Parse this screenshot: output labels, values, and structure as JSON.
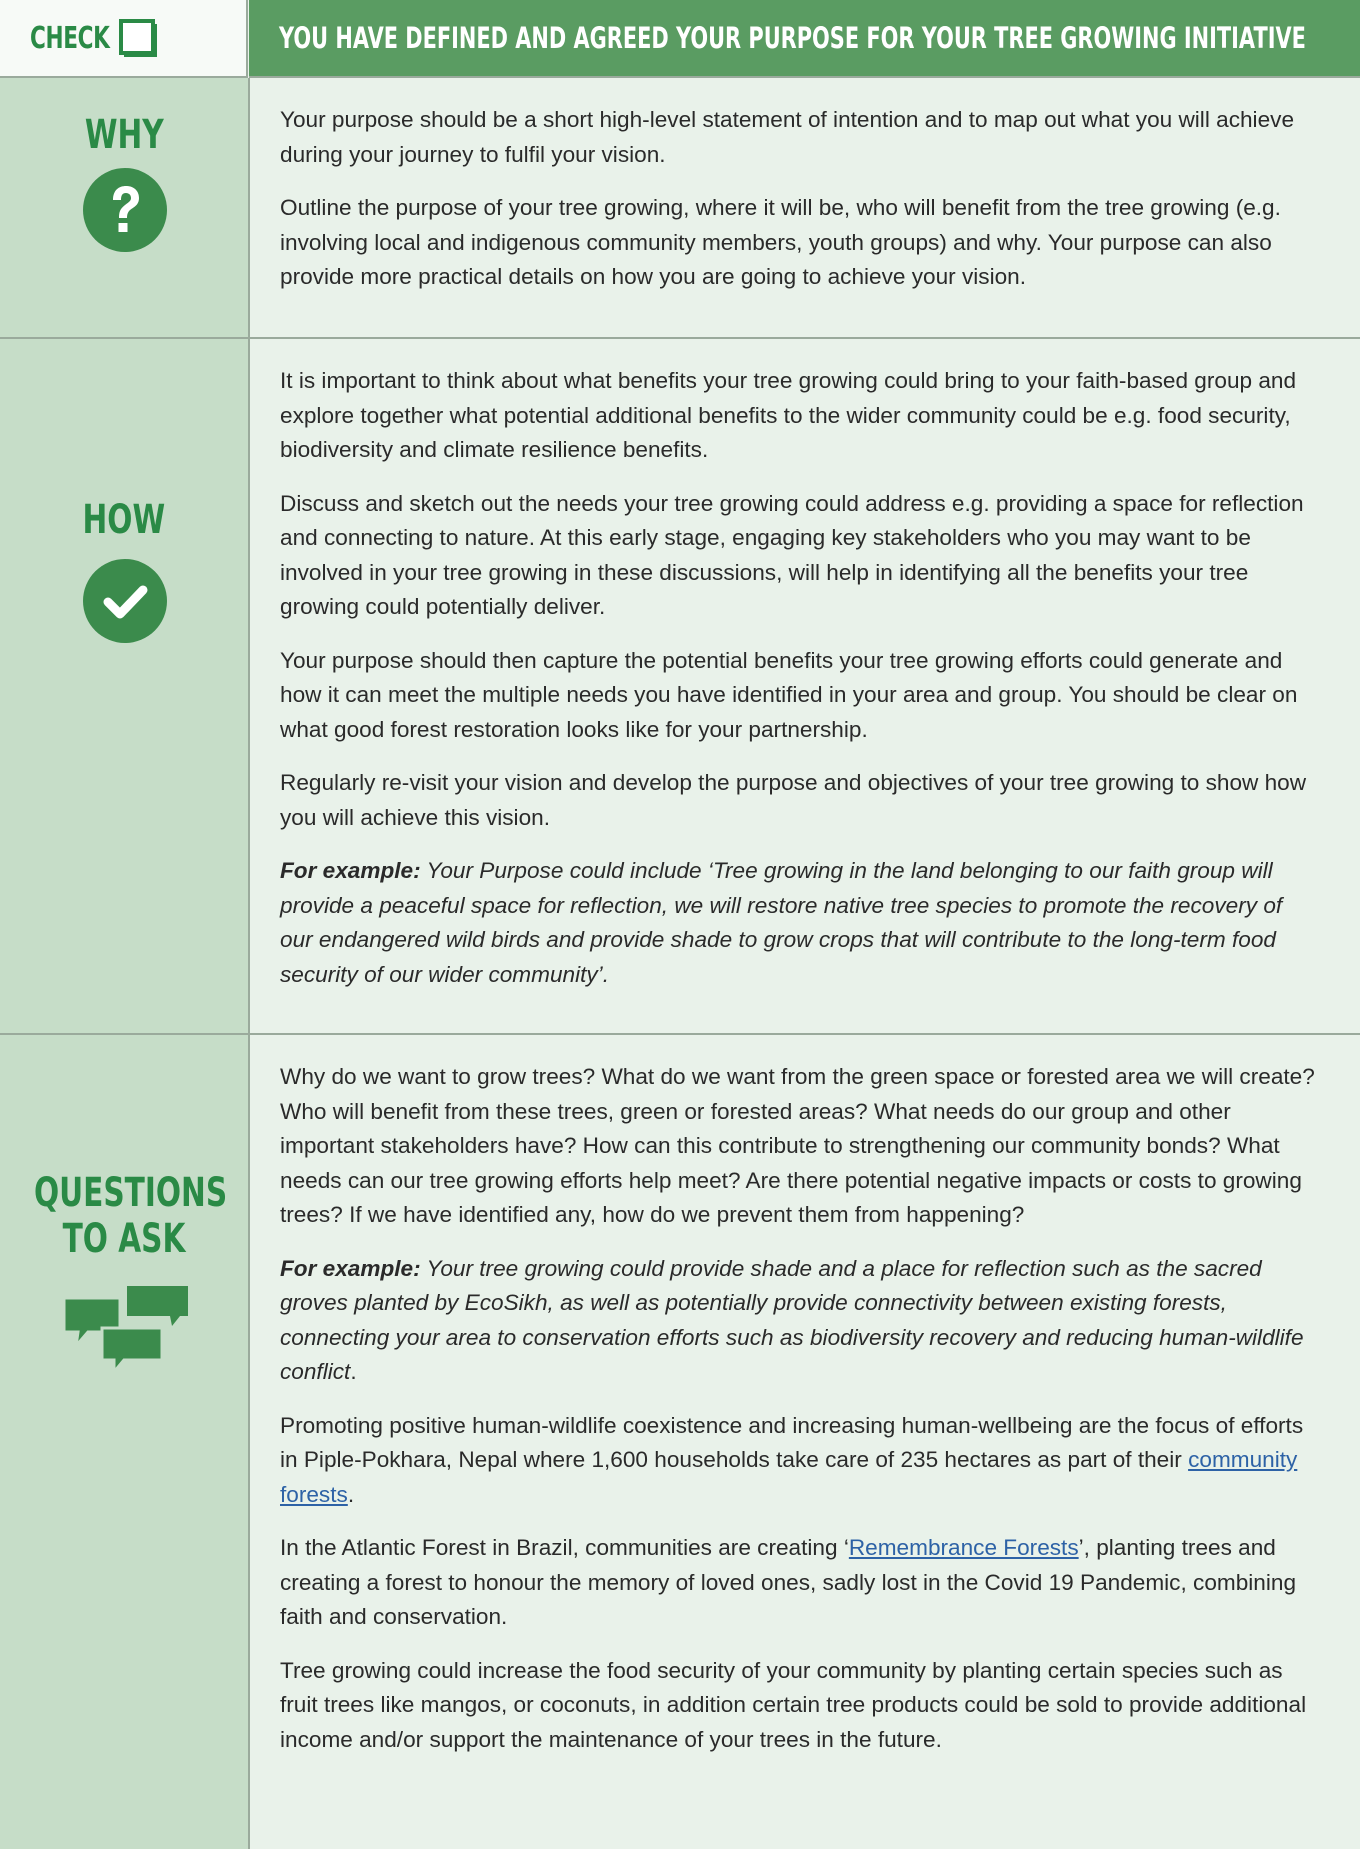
{
  "header": {
    "check_label": "CHECK",
    "title": "YOU HAVE DEFINED AND AGREED YOUR PURPOSE FOR YOUR TREE GROWING INITIATIVE"
  },
  "why": {
    "label": "WHY",
    "icon": "question-icon",
    "paragraphs": [
      "Your purpose should be a short high-level statement of intention and to map out what you will achieve during your journey to fulfil your vision.",
      "Outline the purpose of your tree growing, where it will be, who will benefit from the tree growing (e.g. involving local and indigenous community members, youth groups) and why. Your purpose can also provide more practical details on how you are going to achieve your vision."
    ]
  },
  "how": {
    "label": "HOW",
    "icon": "checkmark-icon",
    "paragraphs": [
      "It is important to think about what benefits your tree growing could bring to your faith-based group and explore together what potential additional benefits to the wider community could be e.g. food security, biodiversity and climate resilience benefits.",
      "Discuss and sketch out the needs your tree growing could address e.g. providing a space for reflection and connecting to nature. At this early stage, engaging key stakeholders who you may want to be involved in your tree growing in these discussions, will help in identifying all the benefits your tree growing could potentially deliver.",
      "Your purpose should then capture the potential benefits your tree growing efforts could generate and how it can meet the multiple needs you have identified in your area and group. You should be clear on what good forest restoration looks like for your partnership.",
      "Regularly re-visit your vision and develop the purpose and objectives of your tree growing to show how you will achieve this vision."
    ],
    "example_lead": "For example:",
    "example_text": " Your Purpose could include ‘Tree growing in the land belonging to our faith group will provide a peaceful space for reflection, we will restore native tree species to promote the recovery of our endangered wild birds and provide shade to grow crops that will contribute to the long-term food security of our wider community’."
  },
  "questions": {
    "label_line1": "QUESTIONS",
    "label_line2": "TO ASK",
    "icon": "speech-bubbles-icon",
    "p1": "Why do we want to grow trees? What do we want from the green space or forested area we will create? Who will benefit from these trees, green or forested areas? What needs do our group and other important stakeholders have? How can this contribute to strengthening our community bonds? What needs can our tree growing efforts help meet? Are there potential negative impacts or costs to growing trees? If we have identified any, how do we prevent them from happening?",
    "example_lead": "For example:",
    "example_text": " Your tree growing could provide shade and a place for reflection such as the sacred groves planted by EcoSikh, as well as potentially provide connectivity between existing forests, connecting your area to conservation efforts such as biodiversity recovery and reducing human-wildlife conflict",
    "example_end": ".",
    "p3_before": "Promoting positive human-wildlife coexistence  and increasing human-wellbeing are the focus of efforts in Piple-Pokhara, Nepal where 1,600 households take care of 235 hectares as part of their ",
    "p3_link": "community forests",
    "p3_after": ".",
    "p4_before": "In the Atlantic Forest in Brazil, communities are creating ‘",
    "p4_link": "Remembrance Forests",
    "p4_after": "’, planting trees and creating a forest to honour the memory of loved ones, sadly lost in the Covid 19 Pandemic, combining faith and conservation.",
    "p5": "Tree growing could increase the food security of your community by planting certain species such as fruit trees like mangos, or coconuts, in addition certain tree products could be sold to provide additional income and/or support the maintenance of your trees in the future."
  }
}
